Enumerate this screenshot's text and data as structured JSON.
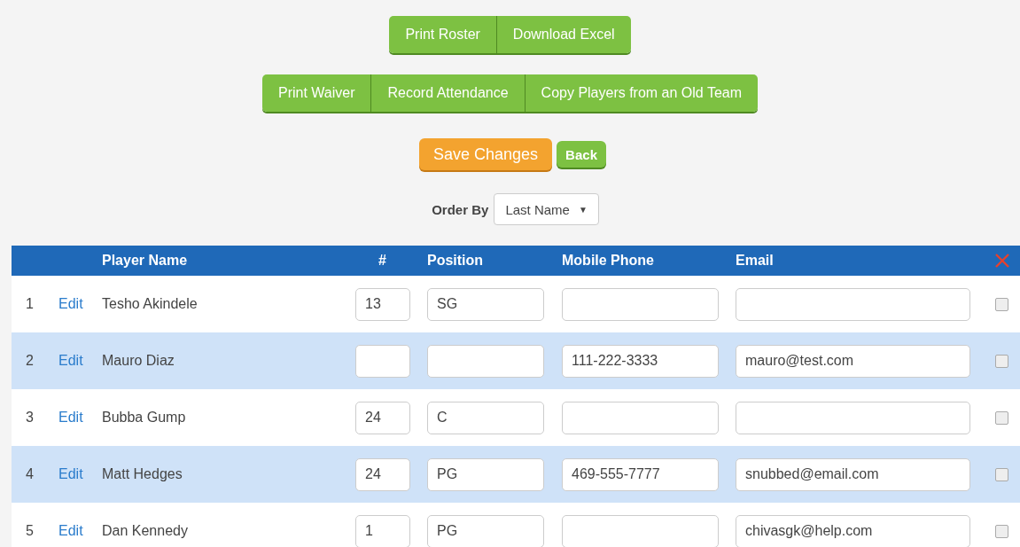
{
  "button_groups": [
    {
      "buttons": [
        "Print Roster",
        "Download Excel"
      ]
    },
    {
      "buttons": [
        "Print Waiver",
        "Record Attendance",
        "Copy Players from an Old Team"
      ]
    }
  ],
  "actions": [
    {
      "label": "Save Changes",
      "kind": "primary"
    },
    {
      "label": "Back",
      "kind": "secondary"
    }
  ],
  "order_by": {
    "label": "Order By",
    "value": "Last Name",
    "caret": "▼"
  },
  "table": {
    "columns": [
      "Player Name",
      "#",
      "Position",
      "Mobile Phone",
      "Email"
    ],
    "rows": [
      {
        "index": "1",
        "edit": "Edit",
        "name": "Tesho Akindele",
        "number": "13",
        "position": "SG",
        "phone": "",
        "email": "",
        "checked": false
      },
      {
        "index": "2",
        "edit": "Edit",
        "name": "Mauro Diaz",
        "number": "",
        "position": "",
        "phone": "111-222-3333",
        "email": "mauro@test.com",
        "checked": false
      },
      {
        "index": "3",
        "edit": "Edit",
        "name": "Bubba Gump",
        "number": "24",
        "position": "C",
        "phone": "",
        "email": "",
        "checked": false
      },
      {
        "index": "4",
        "edit": "Edit",
        "name": "Matt Hedges",
        "number": "24",
        "position": "PG",
        "phone": "469-555-7777",
        "email": "snubbed@email.com",
        "checked": false
      },
      {
        "index": "5",
        "edit": "Edit",
        "name": "Dan Kennedy",
        "number": "1",
        "position": "PG",
        "phone": "",
        "email": "chivasgk@help.com",
        "checked": false
      }
    ]
  }
}
